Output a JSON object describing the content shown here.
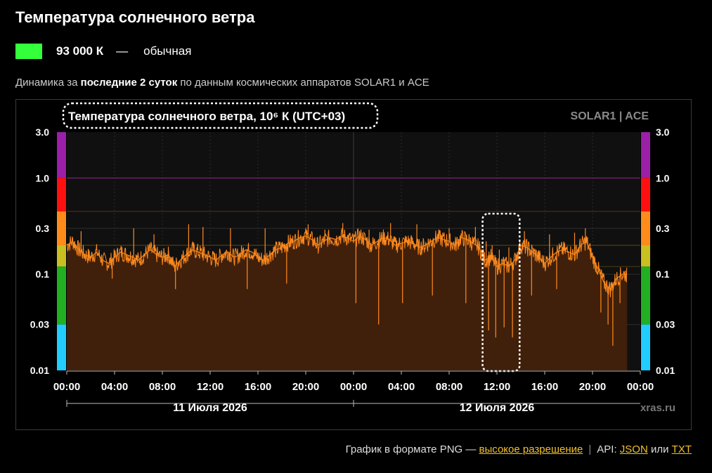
{
  "header": {
    "title": "Температура солнечного ветра"
  },
  "status": {
    "value": "93 000 К",
    "dash": "—",
    "label": "обычная",
    "color": "#33ff3a"
  },
  "subtitle": {
    "prefix": "Динамика за ",
    "bold": "последние 2 суток",
    "suffix": " по данным космических аппаратов SOLAR1 и ACE"
  },
  "chart_data": {
    "type": "area",
    "title": "Температура солнечного ветра, 10⁶ К (UTC+03)",
    "source_label": "SOLAR1 | ACE",
    "watermark": "xras.ru",
    "yscale": "log",
    "ylim": [
      0.01,
      3.0
    ],
    "yticks": [
      {
        "value": 3.0,
        "label": "3.0"
      },
      {
        "value": 1.0,
        "label": "1.0"
      },
      {
        "value": 0.3,
        "label": "0.3"
      },
      {
        "value": 0.1,
        "label": "0.1"
      },
      {
        "value": 0.03,
        "label": "0.03"
      },
      {
        "value": 0.01,
        "label": "0.01"
      }
    ],
    "xrange_hours": [
      0,
      48
    ],
    "xticks": [
      "00:00",
      "04:00",
      "08:00",
      "12:00",
      "16:00",
      "20:00",
      "00:00",
      "04:00",
      "08:00",
      "12:00",
      "16:00",
      "20:00",
      "00:00"
    ],
    "day_labels": [
      {
        "label": "11 Июля 2026",
        "center_hour": 12
      },
      {
        "label": "12 Июля 2026",
        "center_hour": 36
      }
    ],
    "threshold_lines": [
      {
        "value": 1.0,
        "color": "#8e1f8e"
      },
      {
        "value": 0.45,
        "color": "#6b2a12"
      },
      {
        "value": 0.2,
        "color": "#5e4a12"
      },
      {
        "value": 0.12,
        "color": "#4d3c10"
      }
    ],
    "color_scale": [
      {
        "from": 1.0,
        "to": 3.0,
        "color": "#9b1fa8"
      },
      {
        "from": 0.45,
        "to": 1.0,
        "color": "#ff1010"
      },
      {
        "from": 0.2,
        "to": 0.45,
        "color": "#ff8c1a"
      },
      {
        "from": 0.12,
        "to": 0.2,
        "color": "#c8c020"
      },
      {
        "from": 0.03,
        "to": 0.12,
        "color": "#22b022"
      },
      {
        "from": 0.01,
        "to": 0.03,
        "color": "#22ccff"
      }
    ],
    "highlight_hours": [
      34.8,
      37.9
    ],
    "series": [
      {
        "color": "#ff8a1e",
        "fill": "#40200a",
        "points": [
          [
            0,
            0.2
          ],
          [
            0.5,
            0.22
          ],
          [
            1,
            0.18
          ],
          [
            1.5,
            0.16
          ],
          [
            2,
            0.15
          ],
          [
            2.5,
            0.17
          ],
          [
            3,
            0.14
          ],
          [
            3.5,
            0.13
          ],
          [
            4,
            0.15
          ],
          [
            4.5,
            0.17
          ],
          [
            5,
            0.16
          ],
          [
            5.5,
            0.15
          ],
          [
            6,
            0.14
          ],
          [
            6.5,
            0.16
          ],
          [
            7,
            0.18
          ],
          [
            7.5,
            0.16
          ],
          [
            8,
            0.15
          ],
          [
            8.5,
            0.16
          ],
          [
            9,
            0.12
          ],
          [
            9.5,
            0.14
          ],
          [
            10,
            0.16
          ],
          [
            10.5,
            0.18
          ],
          [
            11,
            0.17
          ],
          [
            11.5,
            0.16
          ],
          [
            12,
            0.15
          ],
          [
            12.5,
            0.14
          ],
          [
            13,
            0.16
          ],
          [
            13.5,
            0.17
          ],
          [
            14,
            0.15
          ],
          [
            14.5,
            0.16
          ],
          [
            15,
            0.18
          ],
          [
            15.5,
            0.17
          ],
          [
            16,
            0.15
          ],
          [
            16.5,
            0.14
          ],
          [
            17,
            0.16
          ],
          [
            17.5,
            0.18
          ],
          [
            18,
            0.19
          ],
          [
            18.5,
            0.21
          ],
          [
            19,
            0.22
          ],
          [
            19.5,
            0.24
          ],
          [
            20,
            0.25
          ],
          [
            20.5,
            0.23
          ],
          [
            21,
            0.2
          ],
          [
            21.5,
            0.22
          ],
          [
            22,
            0.24
          ],
          [
            22.5,
            0.23
          ],
          [
            23,
            0.25
          ],
          [
            23.5,
            0.24
          ],
          [
            24,
            0.22
          ],
          [
            24.5,
            0.25
          ],
          [
            25,
            0.23
          ],
          [
            25.5,
            0.2
          ],
          [
            26,
            0.22
          ],
          [
            26.5,
            0.24
          ],
          [
            27,
            0.23
          ],
          [
            27.5,
            0.2
          ],
          [
            28,
            0.21
          ],
          [
            28.5,
            0.22
          ],
          [
            29,
            0.21
          ],
          [
            29.5,
            0.19
          ],
          [
            30,
            0.2
          ],
          [
            30.5,
            0.22
          ],
          [
            31,
            0.24
          ],
          [
            31.5,
            0.23
          ],
          [
            32,
            0.22
          ],
          [
            32.5,
            0.2
          ],
          [
            33,
            0.24
          ],
          [
            33.5,
            0.23
          ],
          [
            34,
            0.21
          ],
          [
            34.5,
            0.19
          ],
          [
            35,
            0.14
          ],
          [
            35.5,
            0.15
          ],
          [
            36,
            0.12
          ],
          [
            36.5,
            0.13
          ],
          [
            37,
            0.12
          ],
          [
            37.5,
            0.14
          ],
          [
            38,
            0.2
          ],
          [
            38.5,
            0.19
          ],
          [
            39,
            0.17
          ],
          [
            39.5,
            0.15
          ],
          [
            40,
            0.13
          ],
          [
            40.5,
            0.15
          ],
          [
            41,
            0.17
          ],
          [
            41.5,
            0.18
          ],
          [
            42,
            0.17
          ],
          [
            42.5,
            0.16
          ],
          [
            43,
            0.2
          ],
          [
            43.5,
            0.22
          ],
          [
            44,
            0.15
          ],
          [
            44.5,
            0.11
          ],
          [
            45,
            0.08
          ],
          [
            45.5,
            0.07
          ],
          [
            46,
            0.09
          ],
          [
            46.5,
            0.1
          ],
          [
            46.9,
            0.1
          ]
        ],
        "spikes": [
          [
            1.2,
            0.28
          ],
          [
            3.8,
            0.09
          ],
          [
            5.6,
            0.3
          ],
          [
            7.3,
            0.26
          ],
          [
            9.1,
            0.07
          ],
          [
            10.2,
            0.33
          ],
          [
            11.4,
            0.31
          ],
          [
            13.7,
            0.3
          ],
          [
            15.1,
            0.07
          ],
          [
            16.6,
            0.3
          ],
          [
            18.4,
            0.08
          ],
          [
            20.2,
            0.33
          ],
          [
            21.6,
            0.29
          ],
          [
            23.1,
            0.34
          ],
          [
            24.2,
            0.05
          ],
          [
            25.3,
            0.29
          ],
          [
            26.1,
            0.03
          ],
          [
            27.1,
            0.34
          ],
          [
            28.1,
            0.05
          ],
          [
            29.3,
            0.33
          ],
          [
            30.6,
            0.06
          ],
          [
            32.0,
            0.3
          ],
          [
            33.4,
            0.05
          ],
          [
            34.2,
            0.31
          ],
          [
            35.1,
            0.22
          ],
          [
            35.3,
            0.026
          ],
          [
            35.6,
            0.2
          ],
          [
            35.9,
            0.022
          ],
          [
            36.2,
            0.18
          ],
          [
            36.6,
            0.028
          ],
          [
            37.0,
            0.19
          ],
          [
            37.3,
            0.022
          ],
          [
            37.6,
            0.16
          ],
          [
            38.3,
            0.28
          ],
          [
            38.9,
            0.06
          ],
          [
            40.4,
            0.26
          ],
          [
            41.0,
            0.07
          ],
          [
            42.5,
            0.27
          ],
          [
            43.4,
            0.3
          ],
          [
            44.7,
            0.04
          ],
          [
            45.3,
            0.03
          ],
          [
            45.7,
            0.018
          ],
          [
            46.3,
            0.05
          ]
        ]
      }
    ]
  },
  "footer": {
    "png_prefix": "График в формате PNG — ",
    "png_link": "высокое разрешение",
    "separator": "|",
    "api_prefix": "API: ",
    "json_link": "JSON",
    "or": " или ",
    "txt_link": "TXT"
  }
}
